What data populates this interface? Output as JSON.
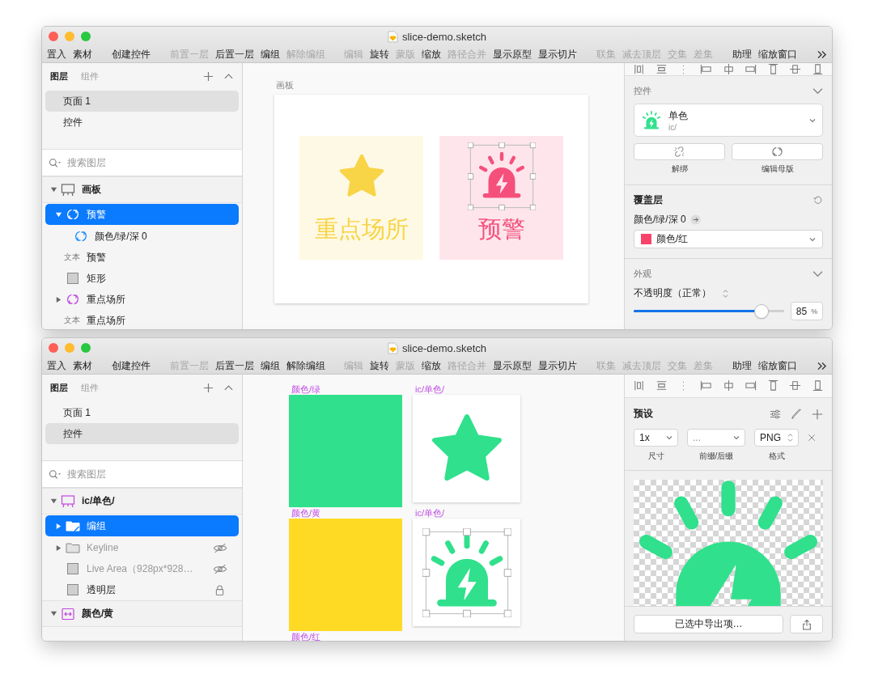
{
  "windows": [
    {
      "title": "slice-demo.sketch",
      "toolbar": [
        {
          "items": [
            {
              "label": "置入",
              "disabled": false
            },
            {
              "label": "素材",
              "disabled": false
            }
          ]
        },
        {
          "items": [
            {
              "label": "创建控件",
              "disabled": false
            }
          ]
        },
        {
          "items": [
            {
              "label": "前置一层",
              "disabled": true
            },
            {
              "label": "后置一层",
              "disabled": false
            },
            {
              "label": "编组",
              "disabled": false
            },
            {
              "label": "解除编组",
              "disabled": true
            }
          ]
        },
        {
          "items": [
            {
              "label": "编辑",
              "disabled": true
            },
            {
              "label": "旋转",
              "disabled": false
            },
            {
              "label": "蒙版",
              "disabled": true
            },
            {
              "label": "缩放",
              "disabled": false
            },
            {
              "label": "路径合并",
              "disabled": true
            },
            {
              "label": "显示原型",
              "disabled": false
            },
            {
              "label": "显示切片",
              "disabled": false
            }
          ]
        },
        {
          "items": [
            {
              "label": "联集",
              "disabled": true
            },
            {
              "label": "减去顶层",
              "disabled": true
            },
            {
              "label": "交集",
              "disabled": true
            },
            {
              "label": "差集",
              "disabled": true
            }
          ]
        },
        {
          "items": [
            {
              "label": "助理",
              "disabled": false
            },
            {
              "label": "缩放窗口",
              "disabled": false
            }
          ]
        }
      ],
      "sidebar": {
        "tabs": [
          {
            "label": "图层",
            "selected": true
          },
          {
            "label": "组件",
            "selected": false
          }
        ],
        "pages": [
          {
            "label": "页面 1",
            "selected": true
          },
          {
            "label": "控件",
            "selected": false
          }
        ],
        "search": {
          "placeholder": "搜索图层"
        },
        "layers": [
          {
            "kind": "artboard",
            "label": "画板",
            "expanded": true,
            "children": [
              {
                "kind": "instance",
                "label": "预警",
                "selected": true,
                "expanded": true,
                "children": [
                  {
                    "kind": "instance",
                    "label": "颜色/绿/深 0",
                    "selected": false
                  }
                ]
              },
              {
                "kind": "text",
                "prefix": "文本",
                "label": "预警",
                "selected": false
              },
              {
                "kind": "rect",
                "label": "矩形",
                "selected": false
              },
              {
                "kind": "symbol",
                "label": "重点场所",
                "selected": false,
                "expanded": false
              },
              {
                "kind": "text",
                "prefix": "文本",
                "label": "重点场所",
                "selected": false
              }
            ]
          }
        ]
      },
      "canvas": {
        "kind": "artboard",
        "title": "画板",
        "tiles": [
          {
            "label": "重点场所",
            "kind": "star",
            "color": "#f8d447",
            "selected": false
          },
          {
            "label": "预警",
            "kind": "alarm",
            "color": "#f5507c",
            "selected": true
          }
        ]
      },
      "inspector": {
        "kind": "symbol",
        "section": "控件",
        "symbol": {
          "name": "单色",
          "path": "ic/"
        },
        "actions": [
          {
            "kind": "unlink",
            "label": "解绑"
          },
          {
            "kind": "edit",
            "label": "编辑母版"
          }
        ],
        "overrides": {
          "title": "覆盖层",
          "label": "颜色/绿/深 0",
          "value": "颜色/红",
          "color": "#f7436a"
        },
        "appearance": {
          "title": "外观",
          "opacity_label": "不透明度（正常）",
          "level": 0.85,
          "value": "85",
          "unit": "%"
        }
      }
    },
    {
      "title": "slice-demo.sketch",
      "toolbar": [
        {
          "items": [
            {
              "label": "置入",
              "disabled": false
            },
            {
              "label": "素材",
              "disabled": false
            }
          ]
        },
        {
          "items": [
            {
              "label": "创建控件",
              "disabled": false
            }
          ]
        },
        {
          "items": [
            {
              "label": "前置一层",
              "disabled": true
            },
            {
              "label": "后置一层",
              "disabled": false
            },
            {
              "label": "编组",
              "disabled": false
            },
            {
              "label": "解除编组",
              "disabled": false
            }
          ]
        },
        {
          "items": [
            {
              "label": "编辑",
              "disabled": true
            },
            {
              "label": "旋转",
              "disabled": false
            },
            {
              "label": "蒙版",
              "disabled": true
            },
            {
              "label": "缩放",
              "disabled": false
            },
            {
              "label": "路径合并",
              "disabled": true
            },
            {
              "label": "显示原型",
              "disabled": false
            },
            {
              "label": "显示切片",
              "disabled": false
            }
          ]
        },
        {
          "items": [
            {
              "label": "联集",
              "disabled": true
            },
            {
              "label": "减去顶层",
              "disabled": true
            },
            {
              "label": "交集",
              "disabled": true
            },
            {
              "label": "差集",
              "disabled": true
            }
          ]
        },
        {
          "items": [
            {
              "label": "助理",
              "disabled": false
            },
            {
              "label": "缩放窗口",
              "disabled": false
            }
          ]
        }
      ],
      "sidebar": {
        "tabs": [
          {
            "label": "图层",
            "selected": true
          },
          {
            "label": "组件",
            "selected": false
          }
        ],
        "pages": [
          {
            "label": "页面 1",
            "selected": false
          },
          {
            "label": "控件",
            "selected": true
          }
        ],
        "search": {
          "placeholder": "搜索图层"
        },
        "layers": [
          {
            "kind": "master",
            "label": "ic/单色/",
            "expanded": true,
            "children": [
              {
                "kind": "group",
                "label": "编组",
                "selected": true,
                "expanded": false,
                "hidden": false,
                "locked": false
              },
              {
                "kind": "folder",
                "label": "Keyline",
                "selected": false,
                "expanded": false,
                "hidden": true,
                "locked": false
              },
              {
                "kind": "rect",
                "label": "Live Area（928px*928…",
                "selected": false,
                "hidden": true,
                "locked": false
              },
              {
                "kind": "rect",
                "label": "透明层",
                "selected": false,
                "hidden": false,
                "locked": true
              }
            ]
          },
          {
            "kind": "linked",
            "label": "颜色/黄",
            "expanded": true
          }
        ]
      },
      "canvas": {
        "kind": "grid",
        "items": [
          {
            "kind": "swatch",
            "label": "颜色/绿",
            "color": "#30e08c"
          },
          {
            "kind": "star",
            "label": "ic/单色/",
            "selected": false
          },
          {
            "kind": "swatch",
            "label": "颜色/黄",
            "color": "#ffda24"
          },
          {
            "kind": "alarm",
            "label": "ic/单色/",
            "selected": true
          },
          {
            "kind": "label",
            "label": "颜色/红"
          }
        ]
      },
      "inspector": {
        "kind": "export",
        "title": "预设",
        "fields": [
          {
            "kind": "dropdown",
            "value": "1x",
            "label": "尺寸"
          },
          {
            "kind": "dropdown",
            "placeholder": "...",
            "label": "前缀/后缀"
          },
          {
            "kind": "stepper",
            "value": "PNG",
            "label": "格式"
          }
        ],
        "button": "已选中导出项…"
      }
    }
  ]
}
